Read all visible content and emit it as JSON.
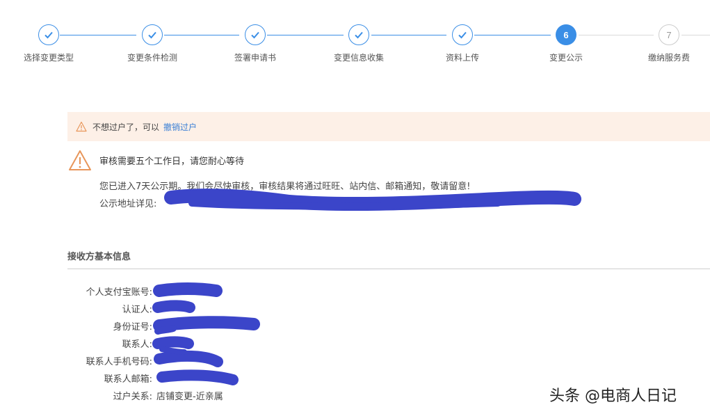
{
  "stepper": {
    "steps": [
      {
        "label": "选择变更类型",
        "state": "done"
      },
      {
        "label": "变更条件检测",
        "state": "done"
      },
      {
        "label": "签署申请书",
        "state": "done"
      },
      {
        "label": "变更信息收集",
        "state": "done"
      },
      {
        "label": "资料上传",
        "state": "done"
      },
      {
        "label": "变更公示",
        "state": "active",
        "number": "6"
      },
      {
        "label": "缴纳服务费",
        "state": "pending",
        "number": "7"
      }
    ],
    "accent_color": "#3a8ee6"
  },
  "banner": {
    "text": "不想过户了，可以",
    "link": "撤销过户",
    "icon": "warning-triangle-icon",
    "background": "#fdf0e7"
  },
  "notice": {
    "title": "审核需要五个工作日，请您耐心等待",
    "description": "您已进入7天公示期。我们会尽快审核，审核结果将通过旺旺、站内信、邮箱通知，敬请留意!",
    "address_label": "公示地址详见:",
    "icon": "warning-triangle-icon"
  },
  "section": {
    "title": "接收方基本信息",
    "fields": [
      {
        "label": "个人支付宝账号:",
        "value": ""
      },
      {
        "label": "认证人:",
        "value": ""
      },
      {
        "label": "身份证号:",
        "value": ""
      },
      {
        "label": "联系人:",
        "value": ""
      },
      {
        "label": "联系人手机号码:",
        "value": ""
      },
      {
        "label": "联系人邮箱:",
        "value": ""
      },
      {
        "label": "过户关系:",
        "value": "店铺变更-近亲属"
      }
    ]
  },
  "redaction_color": "#3b45c9",
  "watermark": "头条 @电商人日记"
}
